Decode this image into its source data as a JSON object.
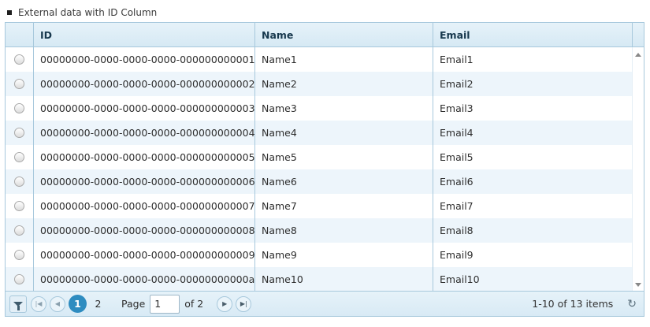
{
  "caption": "External data with ID Column",
  "columns": {
    "id": "ID",
    "name": "Name",
    "email": "Email"
  },
  "rows": [
    {
      "id": "00000000-0000-0000-0000-000000000001",
      "name": "Name1",
      "email": "Email1"
    },
    {
      "id": "00000000-0000-0000-0000-000000000002",
      "name": "Name2",
      "email": "Email2"
    },
    {
      "id": "00000000-0000-0000-0000-000000000003",
      "name": "Name3",
      "email": "Email3"
    },
    {
      "id": "00000000-0000-0000-0000-000000000004",
      "name": "Name4",
      "email": "Email4"
    },
    {
      "id": "00000000-0000-0000-0000-000000000005",
      "name": "Name5",
      "email": "Email5"
    },
    {
      "id": "00000000-0000-0000-0000-000000000006",
      "name": "Name6",
      "email": "Email6"
    },
    {
      "id": "00000000-0000-0000-0000-000000000007",
      "name": "Name7",
      "email": "Email7"
    },
    {
      "id": "00000000-0000-0000-0000-000000000008",
      "name": "Name8",
      "email": "Email8"
    },
    {
      "id": "00000000-0000-0000-0000-000000000009",
      "name": "Name9",
      "email": "Email9"
    },
    {
      "id": "00000000-0000-0000-0000-00000000000a",
      "name": "Name10",
      "email": "Email10"
    }
  ],
  "pager": {
    "pages": [
      "1",
      "2"
    ],
    "page_label": "Page",
    "page_value": "1",
    "of_label": "of 2",
    "items_label": "1-10 of 13 items",
    "refresh_glyph": "↻"
  },
  "colors": {
    "accent": "#2e8cc0",
    "border": "#a7c8dc",
    "alt_row": "#edf5fb"
  }
}
